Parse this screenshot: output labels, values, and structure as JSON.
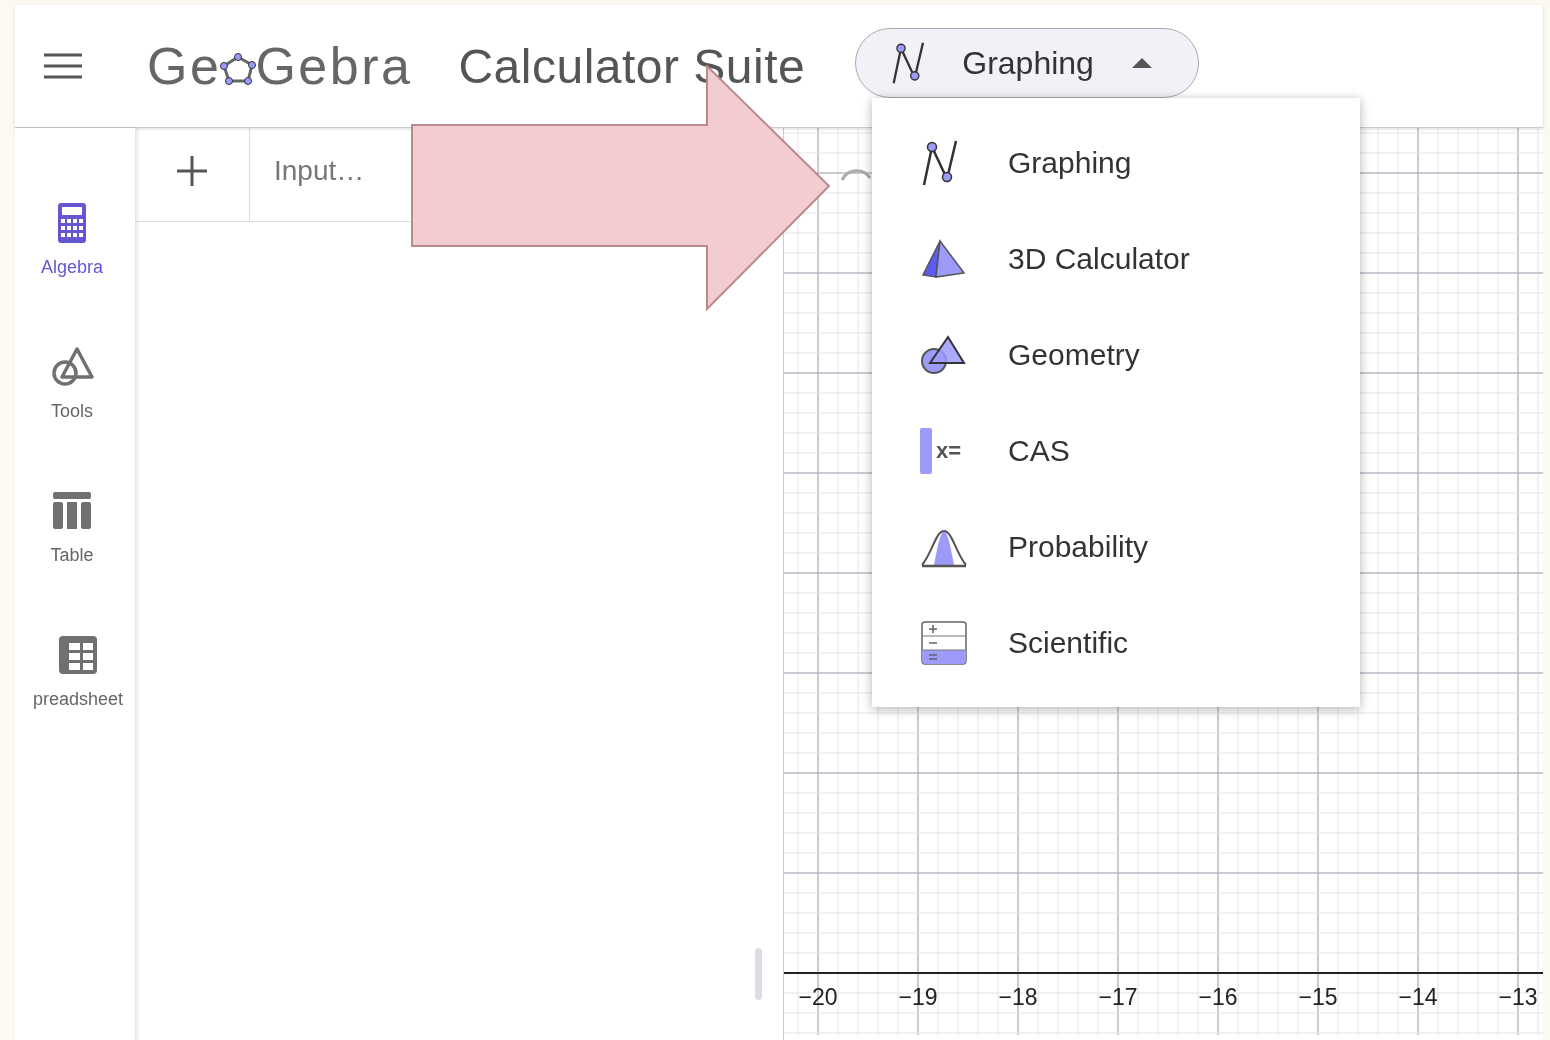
{
  "header": {
    "logo": [
      "Ge",
      "Gebra"
    ],
    "title": "Calculator Suite",
    "app_switcher": {
      "kind": "graphing",
      "label": "Graphing",
      "expanded": true
    }
  },
  "sidebar": {
    "items": [
      {
        "kind": "algebra",
        "label": "Algebra",
        "selected": true
      },
      {
        "kind": "tools",
        "label": "Tools",
        "selected": false
      },
      {
        "kind": "table",
        "label": "Table",
        "selected": false
      },
      {
        "kind": "spreadsheet",
        "label": "preadsheet",
        "selected": false
      }
    ]
  },
  "algebra_input": {
    "placeholder": "Input…"
  },
  "graphics": {
    "x_axis_labels": [
      "−20",
      "−19",
      "−18",
      "−17",
      "−16",
      "−15",
      "−14",
      "−13"
    ]
  },
  "app_menu": {
    "items": [
      {
        "kind": "graphing",
        "label": "Graphing"
      },
      {
        "kind": "pyramid",
        "label": "3D Calculator"
      },
      {
        "kind": "geometry",
        "label": "Geometry"
      },
      {
        "kind": "cas",
        "label": "CAS",
        "icon_text": "x="
      },
      {
        "kind": "probability",
        "label": "Probability"
      },
      {
        "kind": "scientific",
        "label": "Scientific"
      }
    ]
  },
  "annotation": {
    "kind": "arrow"
  }
}
